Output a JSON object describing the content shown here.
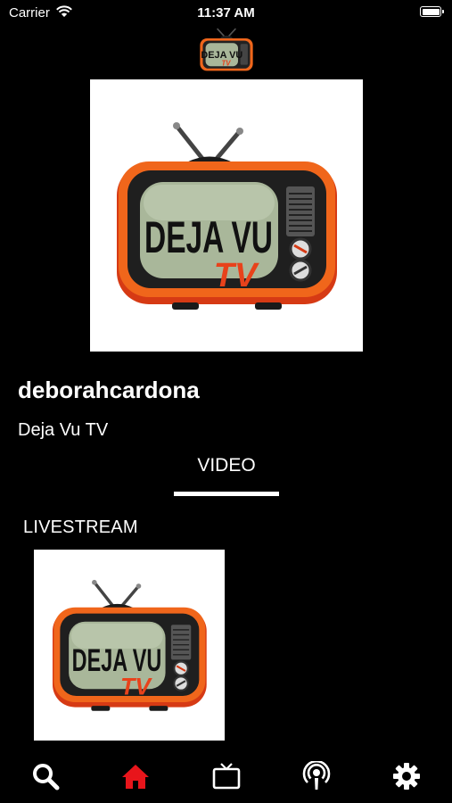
{
  "status_bar": {
    "carrier": "Carrier",
    "time": "11:37 AM"
  },
  "channel": {
    "username": "deborahcardona",
    "title": "Deja Vu TV"
  },
  "logo": {
    "line1": "DEJA VU",
    "line2": "TV"
  },
  "tabs": {
    "active_label": "VIDEO"
  },
  "section": {
    "title": "LIVESTREAM"
  },
  "tabbar": {
    "items": [
      {
        "icon": "search-icon",
        "active": false
      },
      {
        "icon": "home-icon",
        "active": true
      },
      {
        "icon": "tv-icon",
        "active": false
      },
      {
        "icon": "podcast-icon",
        "active": false
      },
      {
        "icon": "gear-icon",
        "active": false
      }
    ]
  },
  "colors": {
    "accent": "#e8151b",
    "tv_orange": "#f0661b",
    "screen": "#a9b79a"
  }
}
